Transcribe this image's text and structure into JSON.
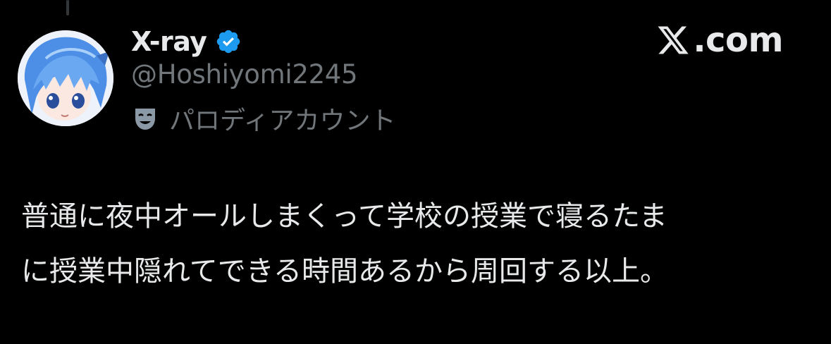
{
  "post": {
    "author": {
      "display_name": "X-ray",
      "handle": "@Hoshiyomi2245",
      "verified": true,
      "verified_icon": "verified-badge-icon",
      "account_label": "パロディアカウント",
      "account_label_icon": "parody-mask-icon",
      "avatar": "anime-character-avatar"
    },
    "brand": {
      "icon": "x-logo-icon",
      "text": ".com"
    },
    "text_line_1": "普通に夜中オールしまくって学校の授業で寝るたま",
    "text_line_2": "に授業中隠れてできる時間あるから周回する以上。"
  },
  "colors": {
    "background": "#000000",
    "primary_text": "#e7e9ea",
    "secondary_text": "#71767b",
    "verified_blue": "#1d9bf0"
  }
}
